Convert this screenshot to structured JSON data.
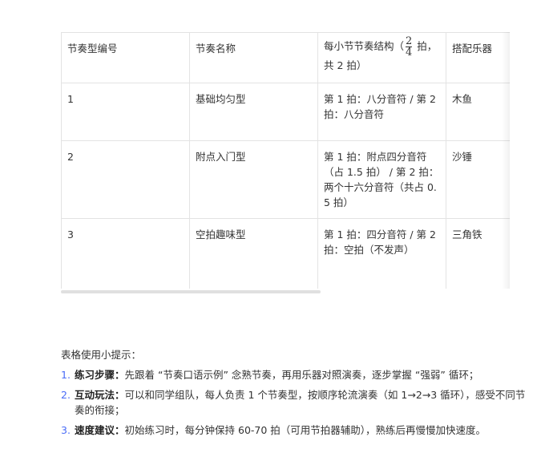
{
  "table": {
    "headers": [
      "节奏型编号",
      "节奏名称",
      "每小节节奏结构（",
      "搭配乐器"
    ],
    "header_frac": {
      "num": "2",
      "den": "4"
    },
    "header_suffix": " 拍，共 2 拍）",
    "rows": [
      [
        "1",
        "基础均匀型",
        "第 1 拍：八分音符 / 第 2 拍：八分音符",
        "木鱼"
      ],
      [
        "2",
        "附点入门型",
        "第 1 拍：附点四分音符（占 1.5 拍） / 第 2 拍：两个十六分音符（共占 0.5 拍）",
        "沙锤"
      ],
      [
        "3",
        "空拍趣味型",
        "第 1 拍：四分音符 / 第 2 拍：空拍（不发声）",
        "三角铁"
      ]
    ]
  },
  "tips": {
    "title": "表格使用小提示：",
    "items": [
      {
        "num": "1.",
        "label": "练习步骤：",
        "text": "先跟着 “节奏口语示例” 念熟节奏，再用乐器对照演奏，逐步掌握 “强弱” 循环；"
      },
      {
        "num": "2.",
        "label": "互动玩法：",
        "text": "可以和同学组队，每人负责 1 个节奏型，按顺序轮流演奏（如 1→2→3 循环），感受不同节奏的衔接；"
      },
      {
        "num": "3.",
        "label": "速度建议：",
        "text": "初始练习时，每分钟保持 60-70 拍（可用节拍器辅助），熟练后再慢慢加快速度。"
      }
    ]
  }
}
